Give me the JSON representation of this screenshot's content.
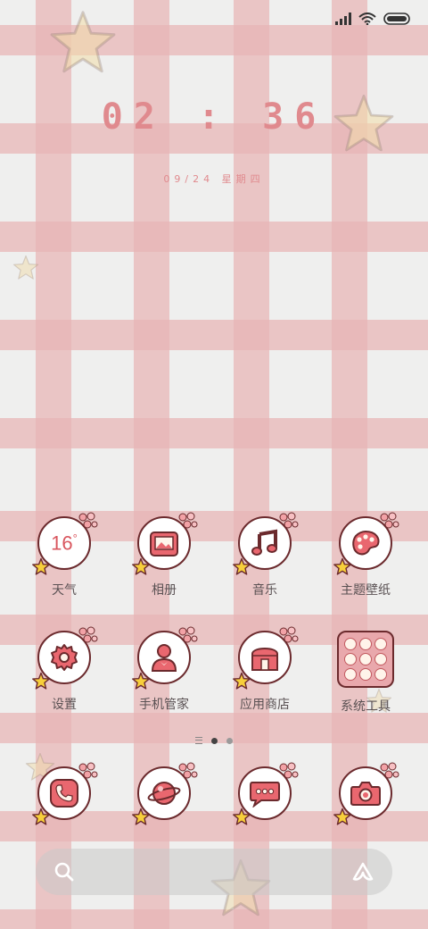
{
  "status_bar": {
    "signal_icon": "signal-icon",
    "wifi_icon": "wifi-icon",
    "battery_icon": "battery-icon"
  },
  "clock": {
    "time": "02 : 36",
    "date": "09/24 星期四"
  },
  "apps_row1": [
    {
      "label": "天气",
      "icon": "weather-icon",
      "temp": "16",
      "unit": "°"
    },
    {
      "label": "相册",
      "icon": "gallery-icon"
    },
    {
      "label": "音乐",
      "icon": "music-icon"
    },
    {
      "label": "主题壁纸",
      "icon": "palette-icon"
    }
  ],
  "apps_row2": [
    {
      "label": "设置",
      "icon": "settings-icon"
    },
    {
      "label": "手机管家",
      "icon": "security-icon"
    },
    {
      "label": "应用商店",
      "icon": "store-icon"
    },
    {
      "label": "系统工具",
      "icon": "folder-icon"
    }
  ],
  "dock": [
    {
      "icon": "phone-icon"
    },
    {
      "icon": "browser-icon"
    },
    {
      "icon": "messages-icon"
    },
    {
      "icon": "camera-icon"
    }
  ],
  "page_indicator": {
    "pages": 2,
    "active": 1
  },
  "search": {
    "search_icon": "search-icon",
    "assistant_icon": "assistant-icon"
  },
  "colors": {
    "accent": "#e08a8e",
    "icon_fill": "#e9676f",
    "outline": "#6b2a2d",
    "band": "#e8b4b6"
  }
}
